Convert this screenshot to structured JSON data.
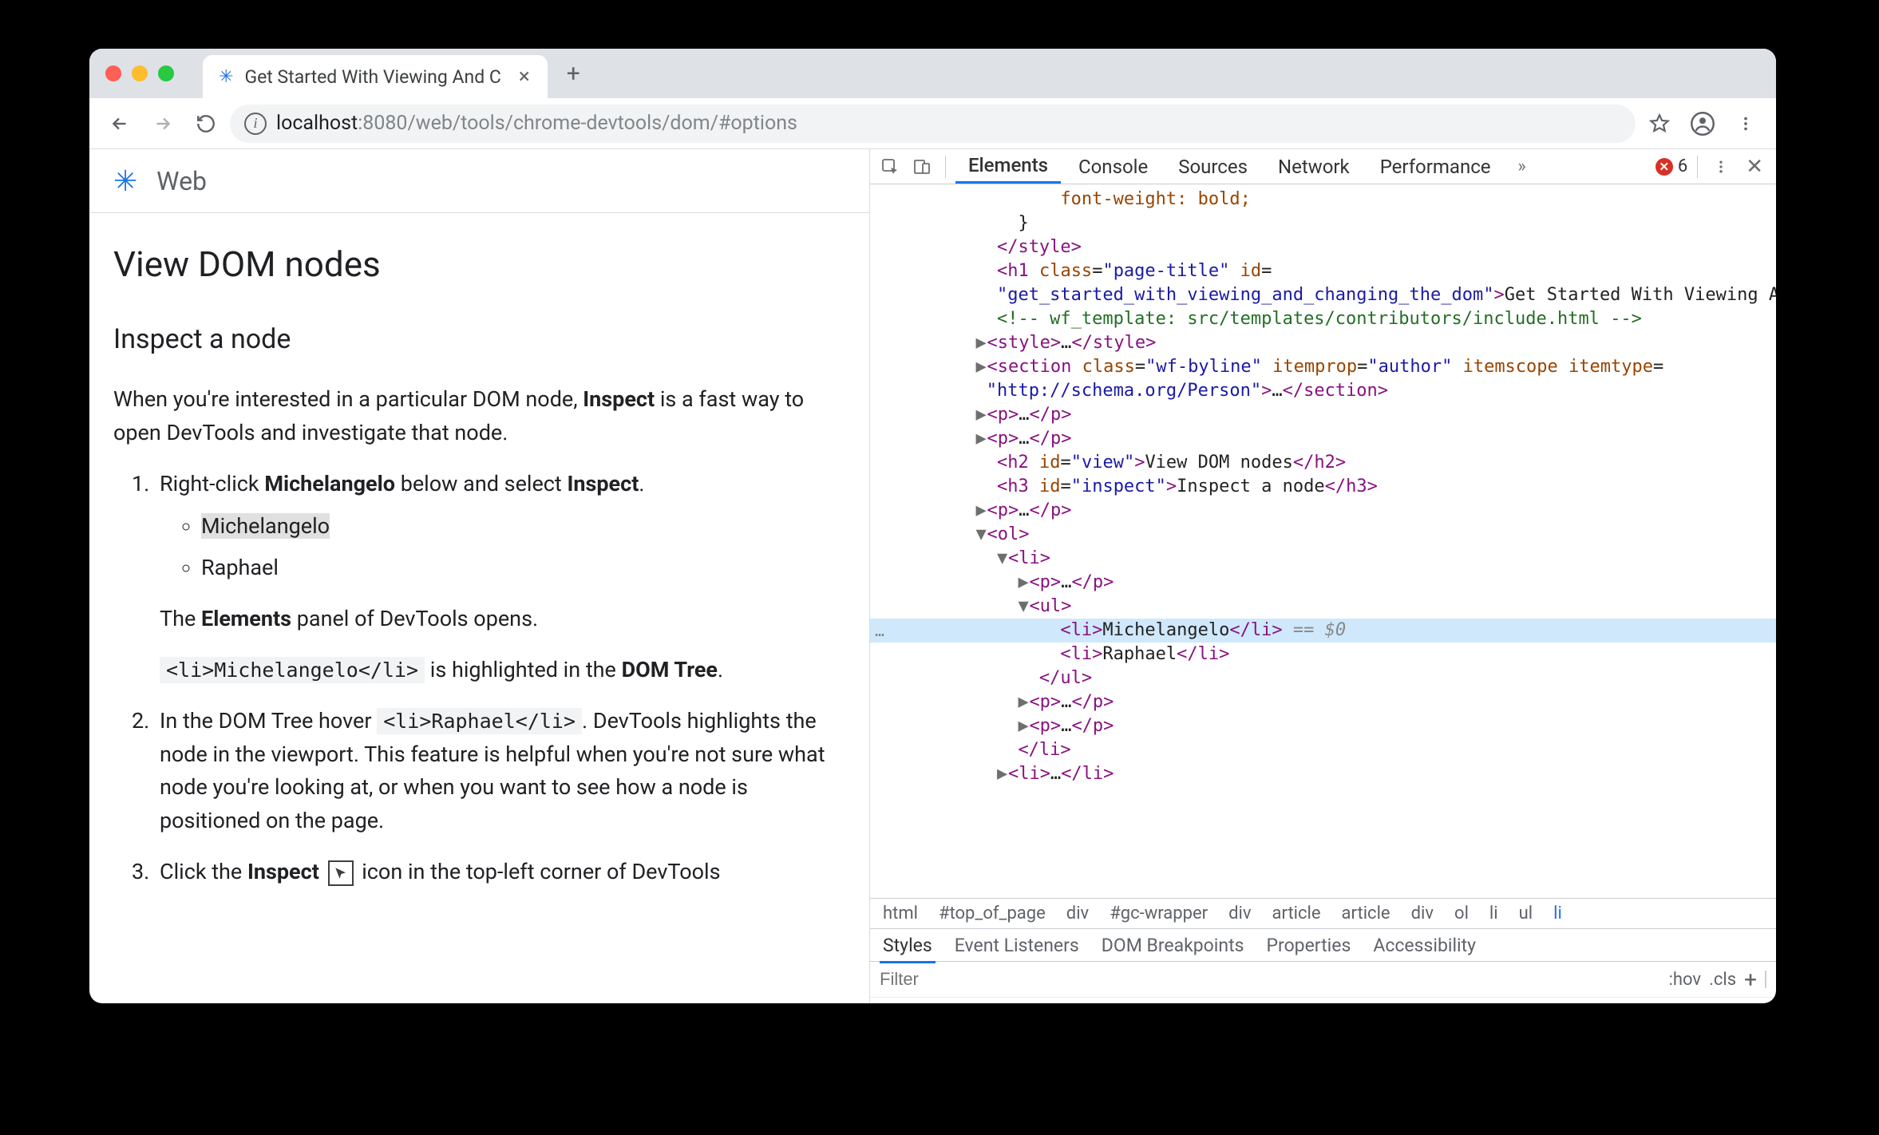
{
  "browser": {
    "tab_title": "Get Started With Viewing And C",
    "url_host": "localhost",
    "url_port": ":8080",
    "url_path": "/web/tools/chrome-devtools/dom/#options"
  },
  "page": {
    "site_name": "Web",
    "h2": "View DOM nodes",
    "h3": "Inspect a node",
    "intro_pre": "When you're interested in a particular DOM node, ",
    "intro_bold": "Inspect",
    "intro_post": " is a fast way to open DevTools and investigate that node.",
    "step1_pre": "Right-click ",
    "step1_bold": "Michelangelo",
    "step1_mid": " below and select ",
    "step1_bold2": "Inspect",
    "step1_post": ".",
    "li_michelangelo": "Michelangelo",
    "li_raphael": "Raphael",
    "elements_panel_pre": "The ",
    "elements_panel_bold": "Elements",
    "elements_panel_post": " panel of DevTools opens.",
    "code_li_m": "<li>Michelangelo</li>",
    "code_li_m_after_pre": " is highlighted in the ",
    "code_li_m_after_bold": "DOM Tree",
    "code_li_m_after_post": ".",
    "step2_pre": "In the DOM Tree hover ",
    "step2_code": "<li>Raphael</li>",
    "step2_post": ". DevTools highlights the node in the viewport. This feature is helpful when you're not sure what node you're looking at, or when you want to see how a node is positioned on the page.",
    "step3_pre": "Click the ",
    "step3_bold": "Inspect",
    "step3_post": " icon in the top-left corner of DevTools"
  },
  "devtools": {
    "tabs": [
      "Elements",
      "Console",
      "Sources",
      "Network",
      "Performance"
    ],
    "active_tab": "Elements",
    "error_count": "6",
    "style_fragment": "font-weight: bold;",
    "h1_class": "page-title",
    "h1_id": "get_started_with_viewing_and_changing_the_dom",
    "h1_text": "Get Started With Viewing And Changing The DOM",
    "comment": " wf_template: src/templates/contributors/include.html ",
    "section_class": "wf-byline",
    "section_itemprop": "author",
    "section_itemtype": "http://schema.org/Person",
    "h2_id": "view",
    "h2_text": "View DOM nodes",
    "h3_id": "inspect",
    "h3_text": "Inspect a node",
    "li_m": "Michelangelo",
    "li_r": "Raphael",
    "selected_suffix": " == $0",
    "breadcrumbs": [
      "html",
      "#top_of_page",
      "div",
      "#gc-wrapper",
      "div",
      "article",
      "article",
      "div",
      "ol",
      "li",
      "ul",
      "li"
    ],
    "styles_tabs": [
      "Styles",
      "Event Listeners",
      "DOM Breakpoints",
      "Properties",
      "Accessibility"
    ],
    "styles_active": "Styles",
    "filter_placeholder": "Filter",
    "hov": ":hov",
    "cls": ".cls"
  }
}
